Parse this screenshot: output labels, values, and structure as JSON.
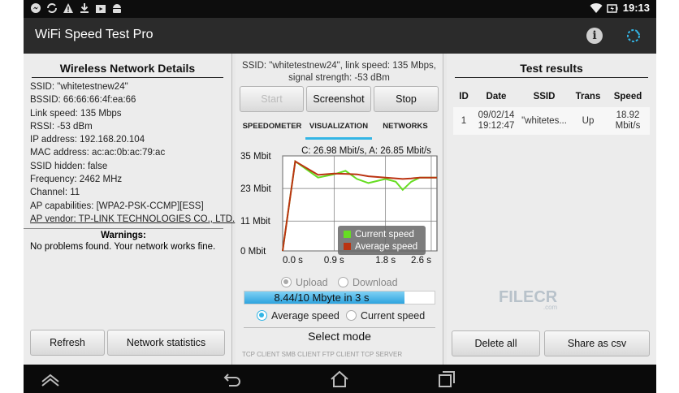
{
  "status_bar": {
    "icons": [
      "messenger-icon",
      "sync-icon",
      "warning-icon",
      "download-icon",
      "store-icon",
      "android-icon"
    ],
    "time": "19:13"
  },
  "app": {
    "title": "WiFi Speed Test Pro"
  },
  "left": {
    "header": "Wireless Network Details",
    "details": [
      "SSID: \"whitetestnew24\"",
      "BSSID: 66:66:66:4f:ea:66",
      "Link speed: 135 Mbps",
      "RSSI: -53 dBm",
      "IP address: 192.168.20.104",
      "MAC address: ac:ac:0b:ac:79:ac",
      "SSID hidden: false",
      "Frequency: 2462 MHz",
      "Channel: 11",
      "AP capabilities: [WPA2-PSK-CCMP][ESS]",
      "AP vendor: TP-LINK TECHNOLOGIES CO., LTD."
    ],
    "warnings_title": "Warnings:",
    "warnings_text": "No problems found. Your network works fine.",
    "refresh_button": "Refresh",
    "network_stats_button": "Network statistics"
  },
  "middle": {
    "info_line1": "SSID: \"whitetestnew24\", link speed: 135 Mbps,",
    "info_line2": "signal strength: -53 dBm",
    "start_button": "Start",
    "screenshot_button": "Screenshot",
    "stop_button": "Stop",
    "tabs": [
      "SPEEDOMETER",
      "VISUALIZATION",
      "NETWORKS"
    ],
    "active_tab": "VISUALIZATION",
    "upload_label": "Upload",
    "download_label": "Download",
    "progress_text": "8.44/10 Mbyte in 3 s",
    "progress_fraction": 0.844,
    "average_label": "Average speed",
    "current_label": "Current speed",
    "select_mode": "Select mode",
    "mode_cut_text": "TCP CLIENT   SMB CLIENT   FTP CLIENT   TCP SERVER"
  },
  "chart_data": {
    "type": "line",
    "title": "C: 26.98 Mbit/s, A: 26.85 Mbit/s",
    "y_tick_labels": [
      "35 Mbit",
      "23 Mbit",
      "11 Mbit",
      "0 Mbit"
    ],
    "y_ticks": [
      35,
      23,
      11,
      0
    ],
    "x_tick_labels": [
      "0.0 s",
      "0.9 s",
      "1.8 s",
      "2.6 s"
    ],
    "x_ticks": [
      0,
      0.9,
      1.8,
      2.6
    ],
    "xlim": [
      0,
      2.7
    ],
    "ylim": [
      0,
      35
    ],
    "grid": true,
    "legend_position": "bottom-right",
    "series": [
      {
        "name": "Current speed",
        "color": "#66dd22",
        "x": [
          0,
          0.22,
          0.62,
          0.9,
          1.1,
          1.3,
          1.5,
          1.8,
          1.98,
          2.1,
          2.25,
          2.4,
          2.7
        ],
        "y": [
          0,
          33,
          27,
          28.2,
          29.5,
          26.5,
          25,
          26.5,
          25.5,
          22.5,
          25.5,
          27,
          27
        ]
      },
      {
        "name": "Average speed",
        "color": "#bb3311",
        "x": [
          0,
          0.22,
          0.62,
          0.9,
          1.1,
          1.3,
          1.5,
          1.8,
          2.1,
          2.25,
          2.4,
          2.7
        ],
        "y": [
          0,
          33,
          28,
          28.5,
          28.4,
          28.2,
          27.5,
          27,
          26.5,
          26.7,
          27,
          27
        ]
      }
    ]
  },
  "right": {
    "header": "Test results",
    "columns": [
      "ID",
      "Date",
      "SSID",
      "Trans",
      "Speed"
    ],
    "rows": [
      {
        "id": "1",
        "date1": "09/02/14",
        "date2": "19:12:47",
        "ssid": "\"whitetes...",
        "trans": "Up",
        "speed1": "18.92",
        "speed2": "Mbit/s"
      }
    ],
    "delete_button": "Delete all",
    "share_button": "Share as csv"
  },
  "watermark": {
    "brand": "FILECR",
    "suffix": ".com"
  },
  "colors": {
    "accent": "#33b5e5",
    "actionbar": "#2b2b2b",
    "statusbar": "#0d0d0d"
  }
}
